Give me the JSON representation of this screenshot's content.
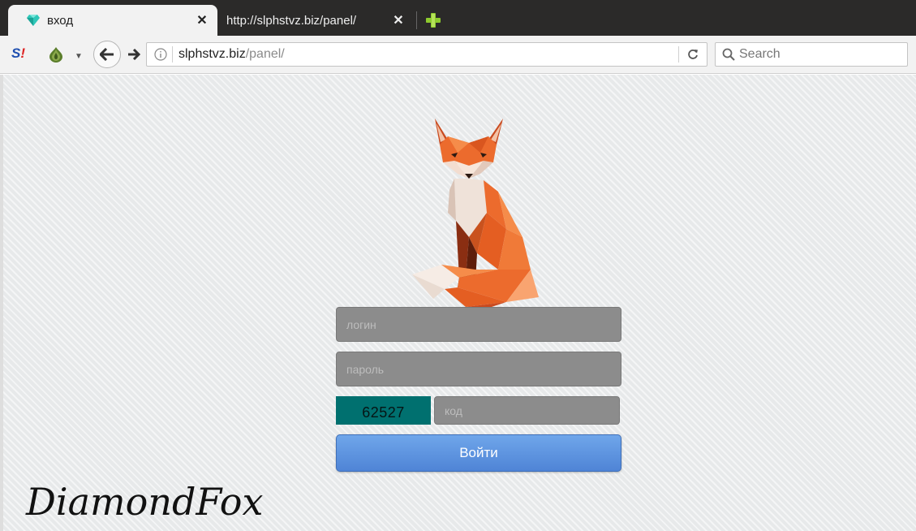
{
  "tabs": [
    {
      "label": "вход",
      "icon": "diamond-icon",
      "active": true
    },
    {
      "label": "http://slphstvz.biz/panel/",
      "active": false
    }
  ],
  "navbar": {
    "url_host": "slphstvz.biz",
    "url_path": "/panel/",
    "search_placeholder": "Search"
  },
  "form": {
    "login_placeholder": "логин",
    "password_placeholder": "пароль",
    "captcha_value": "62527",
    "code_placeholder": "код",
    "submit_label": "Войти"
  },
  "brand": {
    "logo_text": "DiamondFox"
  },
  "colors": {
    "tabstrip": "#2b2a29",
    "captcha_bg": "#00706f",
    "button_top": "#6fa6ea",
    "button_bottom": "#4f84d6",
    "field_bg": "#8c8c8c"
  }
}
